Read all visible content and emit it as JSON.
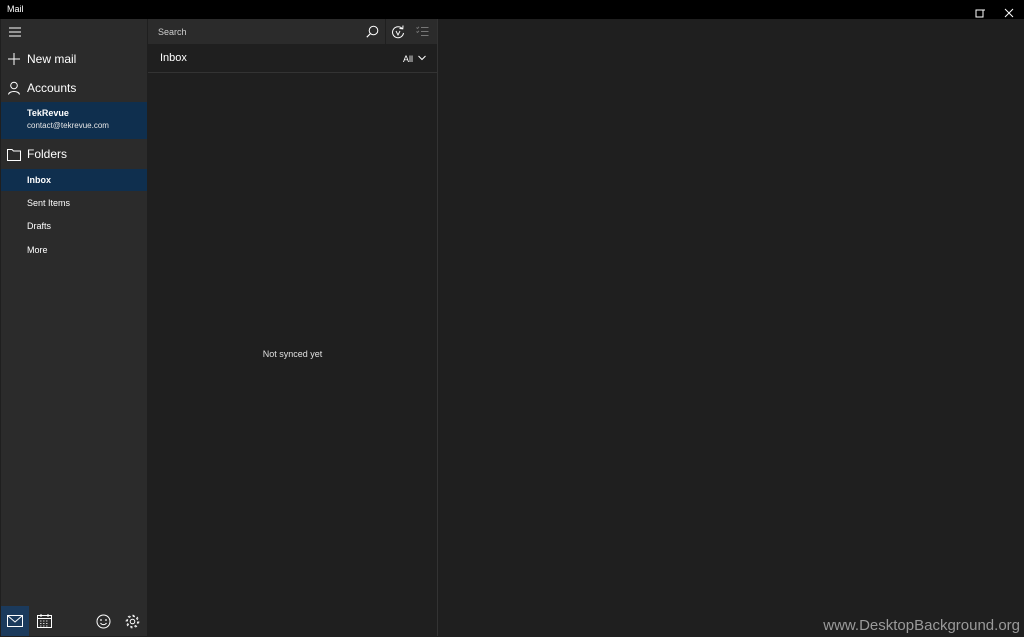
{
  "window": {
    "title": "Mail"
  },
  "nav": {
    "new_mail": "New mail",
    "accounts": "Accounts",
    "account": {
      "name": "TekRevue",
      "email": "contact@tekrevue.com"
    },
    "folders_label": "Folders",
    "folders": [
      {
        "label": "Inbox",
        "selected": true
      },
      {
        "label": "Sent Items",
        "selected": false
      },
      {
        "label": "Drafts",
        "selected": false
      },
      {
        "label": "More",
        "selected": false
      }
    ]
  },
  "list": {
    "search_placeholder": "Search",
    "header_title": "Inbox",
    "filter_value": "All",
    "empty_message": "Not synced yet"
  },
  "watermark": "www.DesktopBackground.org",
  "colors": {
    "accent_selected": "#0f2f4e",
    "nav_bg": "#2b2b2b",
    "pane_bg": "#1f1f1f"
  }
}
